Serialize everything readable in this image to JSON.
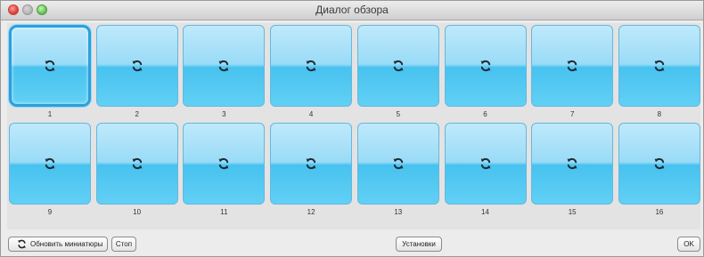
{
  "window": {
    "title": "Диалог обзора"
  },
  "thumbnails": [
    {
      "label": "1",
      "selected": true,
      "icon": "refresh-icon"
    },
    {
      "label": "2",
      "icon": "refresh-icon"
    },
    {
      "label": "3",
      "icon": "refresh-icon"
    },
    {
      "label": "4",
      "icon": "refresh-icon"
    },
    {
      "label": "5",
      "icon": "refresh-icon"
    },
    {
      "label": "6",
      "icon": "refresh-icon"
    },
    {
      "label": "7",
      "icon": "refresh-icon"
    },
    {
      "label": "8",
      "icon": "refresh-icon"
    },
    {
      "label": "9",
      "icon": "refresh-icon"
    },
    {
      "label": "10",
      "icon": "refresh-icon"
    },
    {
      "label": "11",
      "icon": "refresh-icon"
    },
    {
      "label": "12",
      "icon": "refresh-icon"
    },
    {
      "label": "13",
      "icon": "refresh-icon"
    },
    {
      "label": "14",
      "icon": "refresh-icon"
    },
    {
      "label": "15",
      "icon": "refresh-icon"
    },
    {
      "label": "16",
      "icon": "refresh-icon"
    }
  ],
  "buttons": {
    "refresh_label": "Обновить миниатюры",
    "stop_label": "Стоп",
    "settings_label": "Установки",
    "ok_label": "OK"
  }
}
